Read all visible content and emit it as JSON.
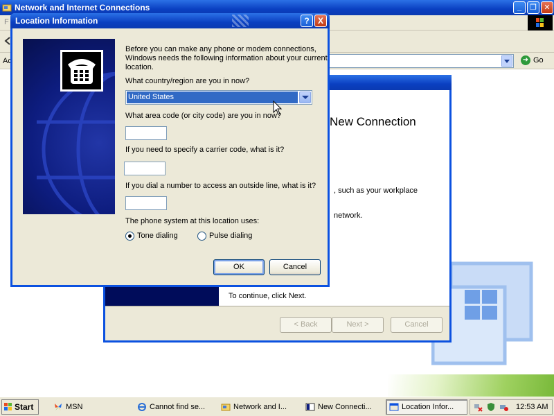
{
  "background_window": {
    "title": "Network and Internet Connections",
    "menu_first_letter": "F",
    "address_label": "Ac",
    "go_label": "Go"
  },
  "wizard": {
    "heading": "New Connection",
    "line_workplace": ", such as your workplace",
    "line_network": "network.",
    "line_continue": "To continue, click Next.",
    "back_label": "< Back",
    "next_label": "Next >",
    "cancel_label": "Cancel"
  },
  "dialog": {
    "title": "Location Information",
    "help_label": "?",
    "close_label": "X",
    "intro_line1": "Before you can make any phone or modem connections,",
    "intro_line2": "Windows needs the following information about your current",
    "intro_line3": "location.",
    "country_question": "What country/region are you in now?",
    "country_value": "United States",
    "area_code_question": "What area code (or city code) are you in now?",
    "area_code_value": "",
    "carrier_question": "If you need to specify a carrier code, what is it?",
    "carrier_value": "",
    "outside_line_question": "If you dial a number to access an outside line, what is it?",
    "outside_line_value": "",
    "phone_system_label": "The phone system at this location uses:",
    "tone_label": "Tone dialing",
    "pulse_label": "Pulse dialing",
    "selected_dialing": "tone",
    "ok_label": "OK",
    "cancel_label": "Cancel",
    "side_icon": "telephone-icon"
  },
  "taskbar": {
    "start_label": "Start",
    "tasks": [
      {
        "label": "MSN",
        "icon": "msn-butterfly-icon"
      },
      {
        "label": "Cannot find se...",
        "icon": "ie-icon"
      },
      {
        "label": "Network and I...",
        "icon": "network-folder-icon"
      },
      {
        "label": "New Connecti...",
        "icon": "wizard-icon"
      },
      {
        "label": "Location Infor...",
        "icon": "dialog-icon",
        "active": true
      }
    ],
    "clock": "12:53 AM"
  },
  "colors": {
    "xp_blue": "#0b51e0",
    "dialog_face": "#ece9d8",
    "selection_blue": "#316ac5",
    "side_panel_navy": "#0d1c7e"
  }
}
